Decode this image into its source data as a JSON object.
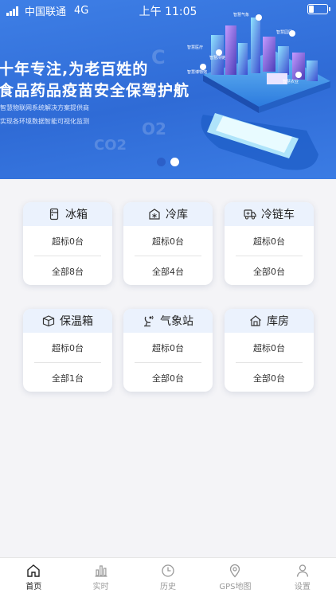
{
  "statusbar": {
    "carrier": "中国联通",
    "network": "4G",
    "time": "上午 11:05"
  },
  "banner": {
    "headline_1": "十年专注,为老百姓的",
    "headline_2": "食品药品疫苗安全保驾护航",
    "sub_1": "智慧物联网系统解决方案提供商",
    "sub_2": "实现各环境数据智能可视化监测",
    "labels": [
      "智慧气象",
      "智慧园区",
      "智慧医疗",
      "智慧冷链",
      "智慧博物馆",
      "智慧农业"
    ],
    "carousel_index": 1,
    "carousel_count": 2
  },
  "devices": [
    {
      "name": "冰箱",
      "icon": "fridge-icon",
      "over": "超标0台",
      "total": "全部8台"
    },
    {
      "name": "冷库",
      "icon": "cold-storage-icon",
      "over": "超标0台",
      "total": "全部4台"
    },
    {
      "name": "冷链车",
      "icon": "cold-chain-truck-icon",
      "over": "超标0台",
      "total": "全部0台"
    },
    {
      "name": "保温箱",
      "icon": "insulated-box-icon",
      "over": "超标0台",
      "total": "全部1台"
    },
    {
      "name": "气象站",
      "icon": "weather-station-icon",
      "over": "超标0台",
      "total": "全部0台"
    },
    {
      "name": "库房",
      "icon": "warehouse-icon",
      "over": "超标0台",
      "total": "全部0台"
    }
  ],
  "tabbar": {
    "active": "home",
    "items": [
      {
        "id": "home",
        "label": "首页",
        "icon": "home-icon"
      },
      {
        "id": "realtime",
        "label": "实时",
        "icon": "bar-chart-icon"
      },
      {
        "id": "history",
        "label": "历史",
        "icon": "clock-icon"
      },
      {
        "id": "gps",
        "label": "GPS地图",
        "icon": "location-pin-icon"
      },
      {
        "id": "settings",
        "label": "设置",
        "icon": "user-icon"
      }
    ]
  }
}
